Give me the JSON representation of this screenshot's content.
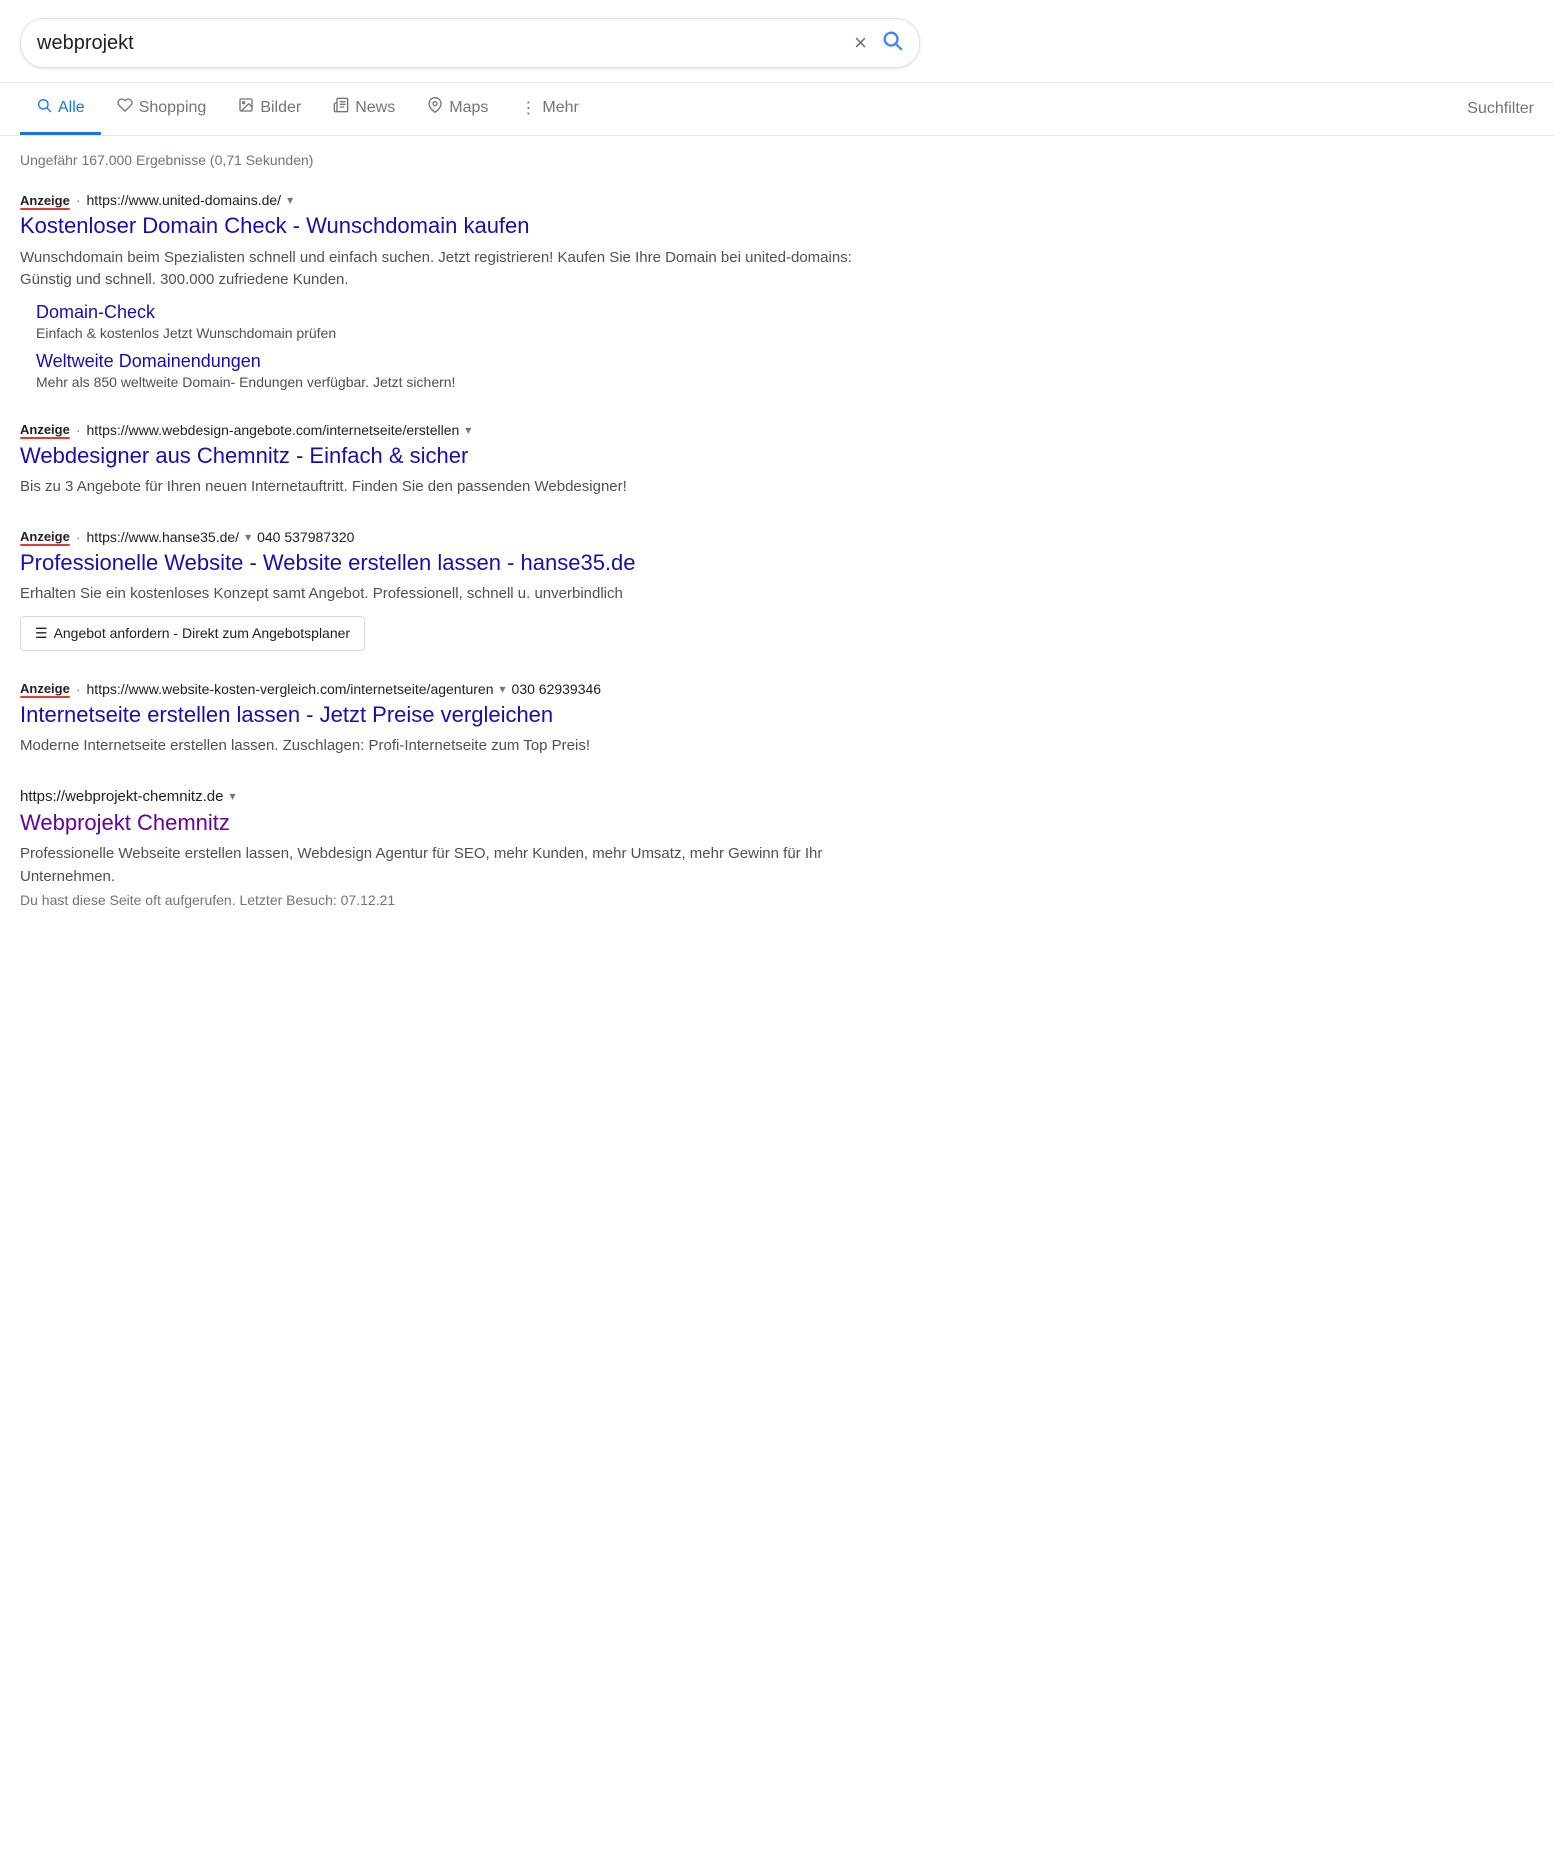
{
  "search": {
    "query": "webprojekt",
    "clear_label": "×",
    "search_icon": "🔍"
  },
  "nav": {
    "tabs": [
      {
        "id": "alle",
        "label": "Alle",
        "icon": "🔍",
        "active": true
      },
      {
        "id": "shopping",
        "label": "Shopping",
        "icon": "◇"
      },
      {
        "id": "bilder",
        "label": "Bilder",
        "icon": "⊡"
      },
      {
        "id": "news",
        "label": "News",
        "icon": "≡"
      },
      {
        "id": "maps",
        "label": "Maps",
        "icon": "📍"
      },
      {
        "id": "mehr",
        "label": "Mehr",
        "icon": "⋮"
      }
    ],
    "suchfilter": "Suchfilter"
  },
  "results_count": "Ungefähr 167.000 Ergebnisse (0,71 Sekunden)",
  "results": [
    {
      "id": "ad1",
      "is_ad": true,
      "ad_label": "Anzeige",
      "url": "https://www.united-domains.de/",
      "has_dropdown": true,
      "title": "Kostenloser Domain Check - Wunschdomain kaufen",
      "snippet": "Wunschdomain beim Spezialisten schnell und einfach suchen. Jetzt registrieren! Kaufen Sie Ihre Domain bei united-domains: Günstig und schnell. 300.000 zufriedene Kunden.",
      "sub_links": [
        {
          "title": "Domain-Check",
          "desc": "Einfach & kostenlos Jetzt Wunschdomain prüfen"
        },
        {
          "title": "Weltweite Domainendungen",
          "desc": "Mehr als 850 weltweite Domain- Endungen verfügbar. Jetzt sichern!"
        }
      ]
    },
    {
      "id": "ad2",
      "is_ad": true,
      "ad_label": "Anzeige",
      "url": "https://www.webdesign-angebote.com/internetseite/erstellen",
      "has_dropdown": true,
      "title": "Webdesigner aus Chemnitz - Einfach & sicher",
      "snippet": "Bis zu 3 Angebote für Ihren neuen Internetauftritt. Finden Sie den passenden Webdesigner!",
      "sub_links": []
    },
    {
      "id": "ad3",
      "is_ad": true,
      "ad_label": "Anzeige",
      "url": "https://www.hanse35.de/",
      "has_dropdown": true,
      "phone": "040 537987320",
      "title": "Professionelle Website - Website erstellen lassen - hanse35.de",
      "snippet": "Erhalten Sie ein kostenloses Konzept samt Angebot. Professionell, schnell u. unverbindlich",
      "action_button": "Angebot anfordern - Direkt zum Angebotsplaner",
      "sub_links": []
    },
    {
      "id": "ad4",
      "is_ad": true,
      "ad_label": "Anzeige",
      "url": "https://www.website-kosten-vergleich.com/internetseite/agenturen",
      "has_dropdown": true,
      "phone": "030 62939346",
      "title": "Internetseite erstellen lassen - Jetzt Preise vergleichen",
      "snippet": "Moderne Internetseite erstellen lassen. Zuschlagen: Profi-Internetseite zum Top Preis!",
      "sub_links": []
    },
    {
      "id": "org1",
      "is_ad": false,
      "url": "https://webprojekt-chemnitz.de",
      "has_dropdown": true,
      "title": "Webprojekt Chemnitz",
      "title_visited": true,
      "snippet": "Professionelle Webseite erstellen lassen, Webdesign Agentur für SEO, mehr Kunden, mehr Umsatz, mehr Gewinn für Ihr Unternehmen.",
      "last_visit": "Du hast diese Seite oft aufgerufen. Letzter Besuch: 07.12.21",
      "sub_links": []
    }
  ]
}
